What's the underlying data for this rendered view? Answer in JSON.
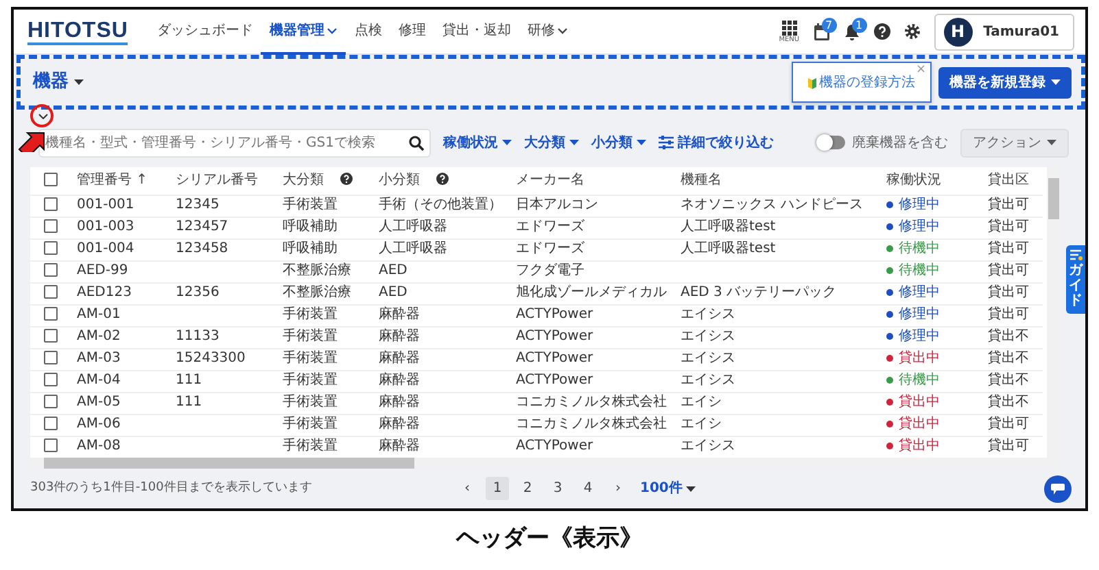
{
  "header": {
    "logo": "HITOTSU",
    "nav": [
      {
        "label": "ダッシュボード",
        "selected": false,
        "dropdown": false
      },
      {
        "label": "機器管理",
        "selected": true,
        "dropdown": true
      },
      {
        "label": "点検",
        "selected": false,
        "dropdown": false
      },
      {
        "label": "修理",
        "selected": false,
        "dropdown": false
      },
      {
        "label": "貸出・返却",
        "selected": false,
        "dropdown": false
      },
      {
        "label": "研修",
        "selected": false,
        "dropdown": true
      }
    ],
    "menu_label": "MENU",
    "calendar_badge": "7",
    "bell_badge": "1",
    "user": {
      "initial": "H",
      "name": "Tamura01"
    }
  },
  "title_bar": {
    "title": "機器",
    "tip": {
      "text": "機器の登録方法",
      "close": "×"
    },
    "register_button": "機器を新規登録"
  },
  "filters": {
    "search": {
      "placeholder": "機種名・型式・管理番号・シリアル番号・GS1で検索"
    },
    "dropdowns": [
      "稼働状況",
      "大分類",
      "小分類"
    ],
    "detail": "詳細で絞り込む",
    "include_disposed": {
      "label": "廃棄機器を含む",
      "on": false
    },
    "action_button": "アクション"
  },
  "table": {
    "columns": [
      {
        "label": "管理番号",
        "sort": "↑",
        "help": false
      },
      {
        "label": "シリアル番号",
        "help": false
      },
      {
        "label": "大分類",
        "help": true
      },
      {
        "label": "小分類",
        "help": true
      },
      {
        "label": "メーカー名",
        "help": false
      },
      {
        "label": "機種名",
        "help": false
      },
      {
        "label": "稼働状況",
        "help": false
      },
      {
        "label": "貸出区",
        "help": false
      }
    ],
    "select_all_checked": false,
    "rows": [
      {
        "checked": false,
        "cells": [
          "001-001",
          "12345",
          "手術装置",
          "手術（その他装置）",
          "日本アルコン",
          "ネオソニックス ハンドピース"
        ],
        "status": {
          "text": "修理中",
          "color": "#1f4fbf"
        },
        "loan": "貸出可"
      },
      {
        "checked": false,
        "cells": [
          "001-003",
          "123457",
          "呼吸補助",
          "人工呼吸器",
          "エドワーズ",
          "人工呼吸器test"
        ],
        "status": {
          "text": "修理中",
          "color": "#1f4fbf"
        },
        "loan": "貸出可"
      },
      {
        "checked": false,
        "cells": [
          "001-004",
          "123458",
          "呼吸補助",
          "人工呼吸器",
          "エドワーズ",
          "人工呼吸器test"
        ],
        "status": {
          "text": "待機中",
          "color": "#3a9a4a"
        },
        "loan": "貸出可"
      },
      {
        "checked": false,
        "cells": [
          "AED-99",
          "",
          "不整脈治療",
          "AED",
          "フクダ電子",
          ""
        ],
        "status": {
          "text": "待機中",
          "color": "#3a9a4a"
        },
        "loan": "貸出可"
      },
      {
        "checked": false,
        "cells": [
          "AED123",
          "12356",
          "不整脈治療",
          "AED",
          "旭化成ゾールメディカル",
          "AED 3 バッテリーパック"
        ],
        "status": {
          "text": "修理中",
          "color": "#1f4fbf"
        },
        "loan": "貸出可"
      },
      {
        "checked": false,
        "cells": [
          "AM-01",
          "",
          "手術装置",
          "麻酔器",
          "ACTYPower",
          "エイシス"
        ],
        "status": {
          "text": "修理中",
          "color": "#1f4fbf"
        },
        "loan": "貸出可"
      },
      {
        "checked": false,
        "cells": [
          "AM-02",
          "11133",
          "手術装置",
          "麻酔器",
          "ACTYPower",
          "エイシス"
        ],
        "status": {
          "text": "修理中",
          "color": "#1f4fbf"
        },
        "loan": "貸出不"
      },
      {
        "checked": false,
        "cells": [
          "AM-03",
          "15243300",
          "手術装置",
          "麻酔器",
          "ACTYPower",
          "エイシス"
        ],
        "status": {
          "text": "貸出中",
          "color": "#d0243c"
        },
        "loan": "貸出不"
      },
      {
        "checked": false,
        "cells": [
          "AM-04",
          "111",
          "手術装置",
          "麻酔器",
          "ACTYPower",
          "エイシス"
        ],
        "status": {
          "text": "待機中",
          "color": "#3a9a4a"
        },
        "loan": "貸出不"
      },
      {
        "checked": false,
        "cells": [
          "AM-05",
          "111",
          "手術装置",
          "麻酔器",
          "コニカミノルタ株式会社",
          "エイシ"
        ],
        "status": {
          "text": "貸出中",
          "color": "#d0243c"
        },
        "loan": "貸出不"
      },
      {
        "checked": false,
        "cells": [
          "AM-06",
          "",
          "手術装置",
          "麻酔器",
          "コニカミノルタ株式会社",
          "エイシ"
        ],
        "status": {
          "text": "貸出中",
          "color": "#d0243c"
        },
        "loan": "貸出可"
      },
      {
        "checked": false,
        "cells": [
          "AM-08",
          "",
          "手術装置",
          "麻酔器",
          "ACTYPower",
          "エイシス"
        ],
        "status": {
          "text": "貸出中",
          "color": "#d0243c"
        },
        "loan": "貸出可"
      }
    ]
  },
  "guide_tab": "ガイド",
  "footer": {
    "summary": "303件のうち1件目-100件目までを表示しています",
    "prev": "‹",
    "pages": [
      {
        "label": "1",
        "selected": true
      },
      {
        "label": "2",
        "selected": false
      },
      {
        "label": "3",
        "selected": false
      },
      {
        "label": "4",
        "selected": false
      }
    ],
    "next": "›",
    "per_page": "100件"
  },
  "caption": "ヘッダー《表示》"
}
